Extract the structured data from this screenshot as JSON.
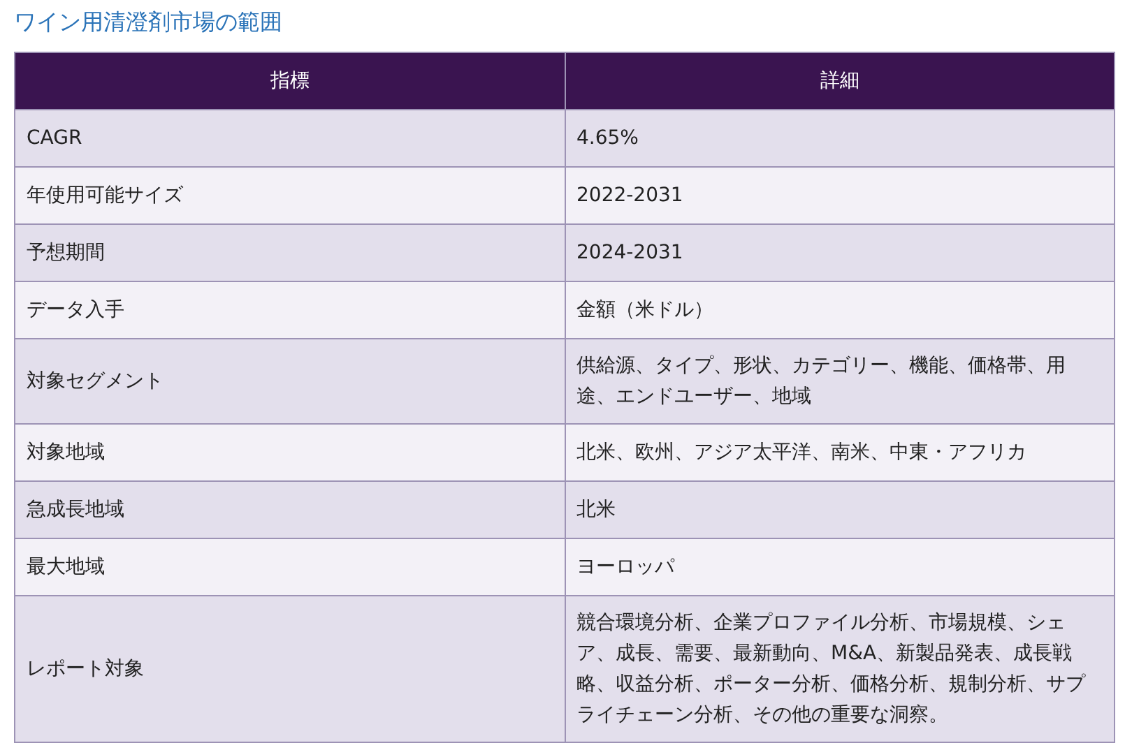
{
  "title": "ワイン用清澄剤市場の範囲",
  "table": {
    "columns": [
      "指標",
      "詳細"
    ],
    "rows": [
      [
        "CAGR",
        "4.65%"
      ],
      [
        "年使用可能サイズ",
        "2022-2031"
      ],
      [
        "予想期間",
        "2024-2031"
      ],
      [
        "データ入手",
        "金額（米ドル）"
      ],
      [
        "対象セグメント",
        "供給源、タイプ、形状、カテゴリー、機能、価格帯、用途、エンドユーザー、地域"
      ],
      [
        "対象地域",
        "北米、欧州、アジア太平洋、南米、中東・アフリカ"
      ],
      [
        "急成長地域",
        "北米"
      ],
      [
        "最大地域",
        "ヨーロッパ"
      ],
      [
        "レポート対象",
        "競合環境分析、企業プロファイル分析、市場規模、シェア、成長、需要、最新動向、M&A、新製品発表、成長戦略、収益分析、ポーター分析、価格分析、規制分析、サプライチェーン分析、その他の重要な洞察。"
      ]
    ]
  }
}
